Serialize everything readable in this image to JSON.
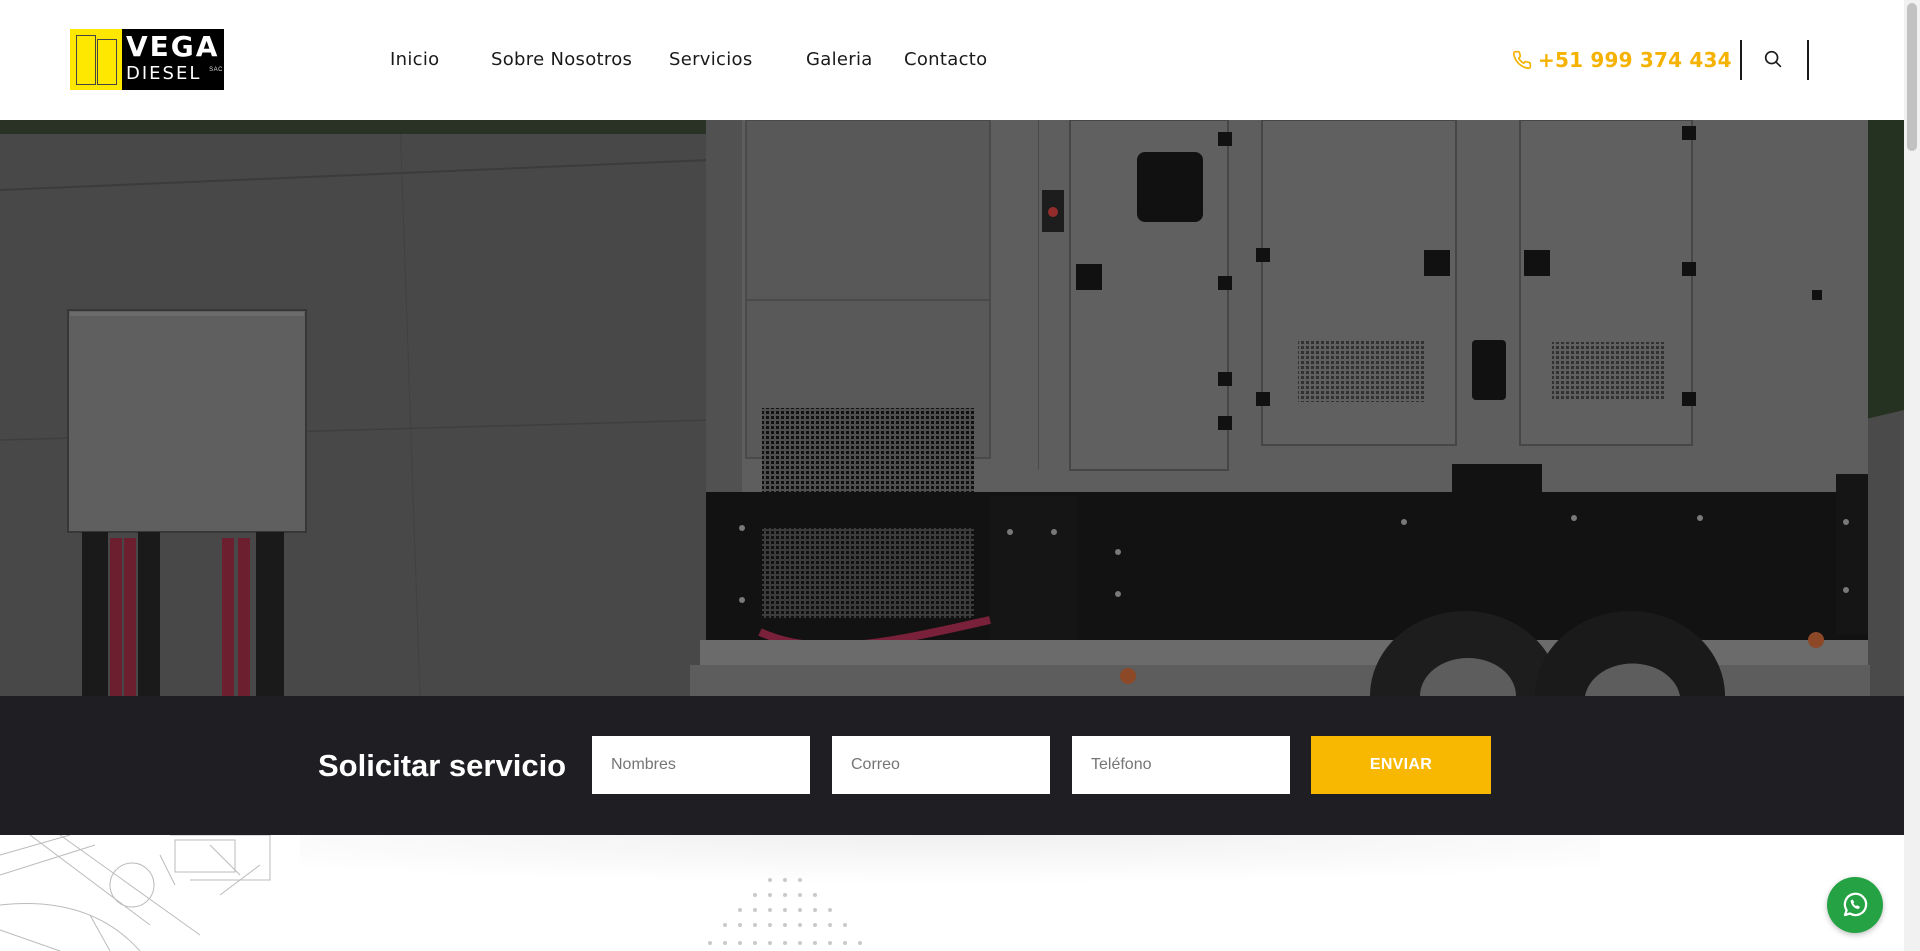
{
  "brand": {
    "logo_top": "VEGA",
    "logo_bottom": "DIESEL",
    "logo_suffix": "SAC"
  },
  "nav": {
    "items": [
      {
        "label": "Inicio"
      },
      {
        "label": "Sobre Nosotros"
      },
      {
        "label": "Servicios"
      },
      {
        "label": "Galeria"
      },
      {
        "label": "Contacto"
      }
    ]
  },
  "header": {
    "phone": "+51 999 374 434"
  },
  "request": {
    "title": "Solicitar servicio",
    "name_placeholder": "Nombres",
    "email_placeholder": "Correo",
    "phone_placeholder": "Teléfono",
    "submit_label": "ENVIAR"
  },
  "colors": {
    "accent": "#f8b700",
    "dark_bar": "#1f1e23",
    "whatsapp": "#25a244",
    "logo_yellow": "#ffe800"
  },
  "icons": {
    "phone": "phone-icon",
    "search": "search-icon",
    "whatsapp": "whatsapp-icon"
  }
}
